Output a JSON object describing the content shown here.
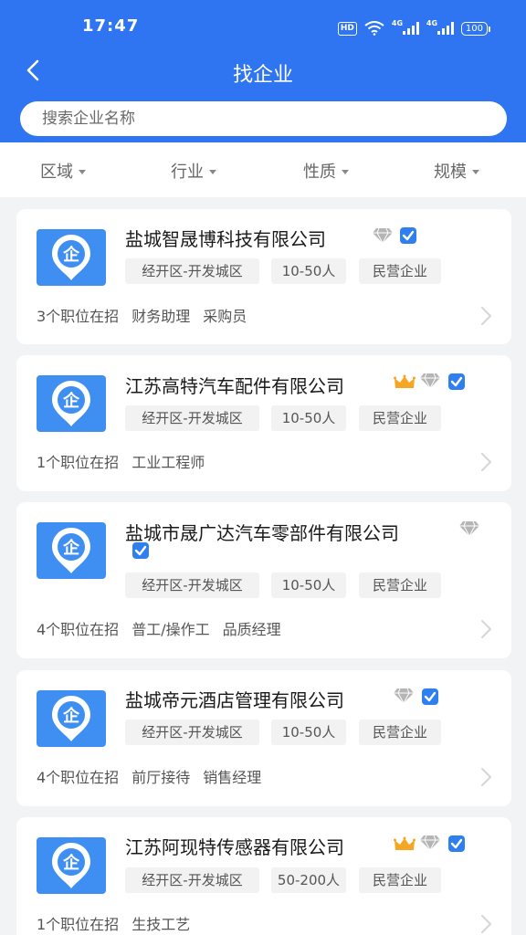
{
  "status": {
    "time": "17:47",
    "battery": "100",
    "network": "4G",
    "hd": "HD"
  },
  "nav": {
    "title": "找企业"
  },
  "search": {
    "placeholder": "搜索企业名称"
  },
  "filters": [
    "区域",
    "行业",
    "性质",
    "规模"
  ],
  "companies": [
    {
      "name": "盐城智晟博科技有限公司",
      "crown": false,
      "tags": [
        "经开区-开发城区",
        "10-50人",
        "民营企业"
      ],
      "jobs_count": "3个职位在招",
      "positions": [
        "财务助理",
        "采购员"
      ]
    },
    {
      "name": "江苏高特汽车配件有限公司",
      "crown": true,
      "tags": [
        "经开区-开发城区",
        "10-50人",
        "民营企业"
      ],
      "jobs_count": "1个职位在招",
      "positions": [
        "工业工程师"
      ]
    },
    {
      "name": "盐城市晟广达汽车零部件有限公司",
      "crown": false,
      "tags": [
        "经开区-开发城区",
        "10-50人",
        "民营企业"
      ],
      "jobs_count": "4个职位在招",
      "positions": [
        "普工/操作工",
        "品质经理"
      ]
    },
    {
      "name": "盐城帝元酒店管理有限公司",
      "crown": false,
      "tags": [
        "经开区-开发城区",
        "10-50人",
        "民营企业"
      ],
      "jobs_count": "4个职位在招",
      "positions": [
        "前厅接待",
        "销售经理"
      ]
    },
    {
      "name": "江苏阿现特传感器有限公司",
      "crown": true,
      "tags": [
        "经开区-开发城区",
        "50-200人",
        "民营企业"
      ],
      "jobs_count": "1个职位在招",
      "positions": [
        "生技工艺"
      ]
    }
  ],
  "logo_char": "企",
  "colors": {
    "primary": "#2f74f0",
    "logo": "#3f8ff2",
    "crown": "#f5a623",
    "verified": "#2f7ff0",
    "diamond": "#b5b5b5"
  }
}
